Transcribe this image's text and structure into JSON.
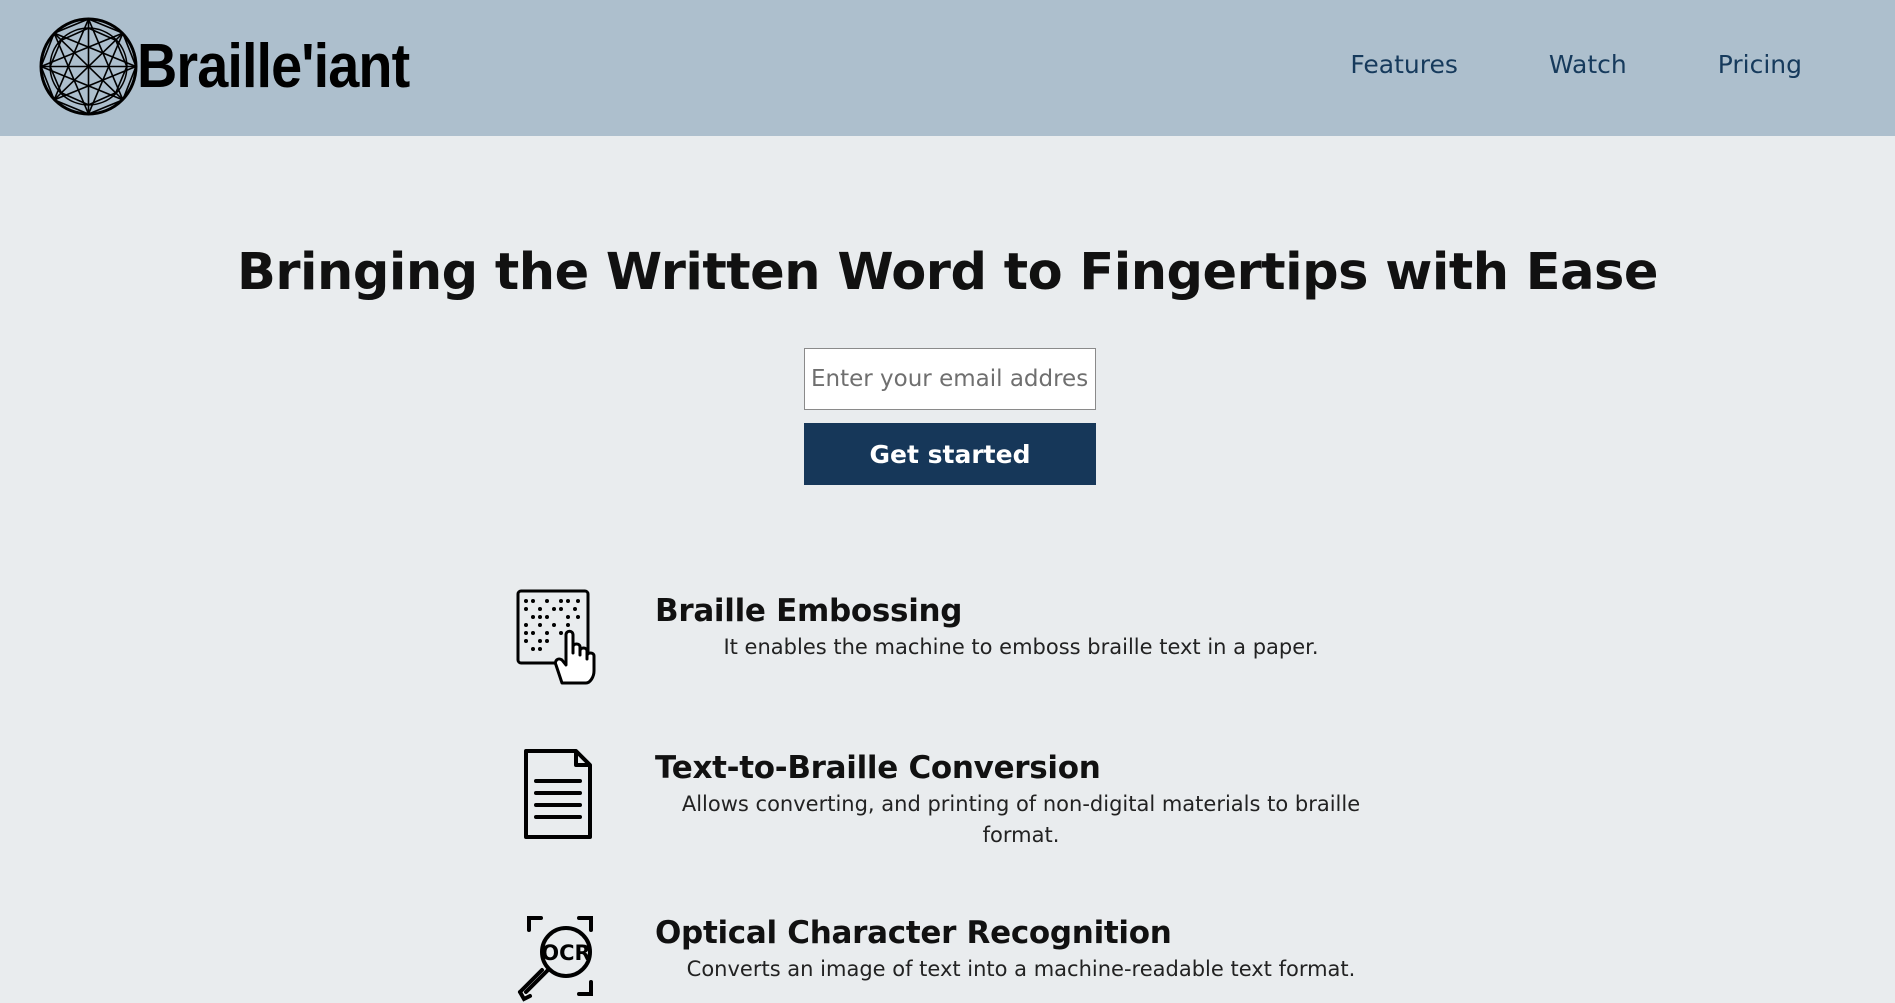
{
  "header": {
    "logo_text": "Braille'iant",
    "nav": [
      {
        "label": "Features"
      },
      {
        "label": "Watch"
      },
      {
        "label": "Pricing"
      }
    ]
  },
  "hero": {
    "title": "Bringing the Written Word to Fingertips with Ease",
    "email_placeholder": "Enter your email address",
    "cta_label": "Get started"
  },
  "features": [
    {
      "icon": "braille-hand-icon",
      "title": "Braille Embossing",
      "description": "It enables the machine to emboss braille text in a paper."
    },
    {
      "icon": "document-icon",
      "title": "Text-to-Braille Conversion",
      "description": "Allows converting, and printing of non-digital materials to braille format."
    },
    {
      "icon": "ocr-magnifier-icon",
      "title": "Optical Character Recognition",
      "description": "Converts an image of text into a machine-readable text format."
    }
  ],
  "colors": {
    "header_bg": "#adbfcd",
    "page_bg": "#e9ecee",
    "accent": "#163759",
    "nav_link": "#163a5c"
  }
}
